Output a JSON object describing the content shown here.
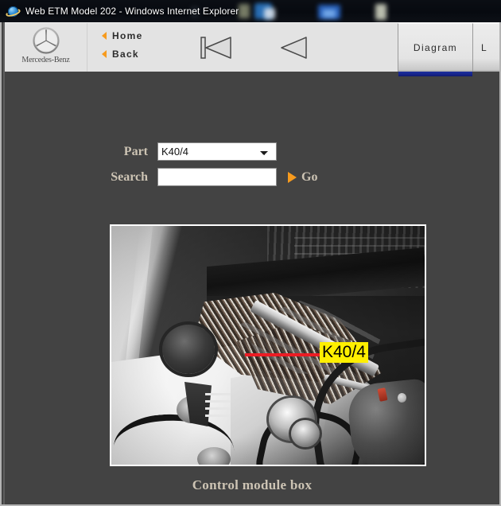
{
  "window": {
    "title": "Web ETM Model 202 - Windows Internet Explorer",
    "browser_icon": "internet-explorer-icon"
  },
  "appbar": {
    "brand": {
      "logo_icon": "mercedes-benz-star-icon",
      "wordmark": "Mercedes-Benz"
    },
    "nav_links": [
      {
        "label": "Home",
        "icon": "triangle-left-icon"
      },
      {
        "label": "Back",
        "icon": "triangle-left-icon"
      }
    ],
    "nav_icons": [
      {
        "name": "skip-to-first-icon"
      },
      {
        "name": "previous-icon"
      }
    ],
    "tabs": [
      {
        "label": "Diagram",
        "active": true
      },
      {
        "label": "L",
        "active": false,
        "clipped": true
      }
    ],
    "accent_blue": "#16248a"
  },
  "form": {
    "part": {
      "label": "Part",
      "value": "K40/4",
      "options": [
        "K40/4"
      ]
    },
    "search": {
      "label": "Search",
      "value": "",
      "placeholder": ""
    },
    "go": {
      "label": "Go",
      "icon": "triangle-right-icon",
      "color": "#f79b1e"
    }
  },
  "diagram": {
    "callout": {
      "label": "K40/4",
      "highlight_color": "#ffef00",
      "pointer_color": "#ec1c24"
    },
    "caption": "Control module box",
    "alt": "Engine bay photograph showing wiring harness and control module box location"
  },
  "colors": {
    "page_background": "#434343",
    "appbar_background": "#e3e3e3",
    "text_tan": "#cdc4b4",
    "accent_orange": "#f79b1e"
  }
}
